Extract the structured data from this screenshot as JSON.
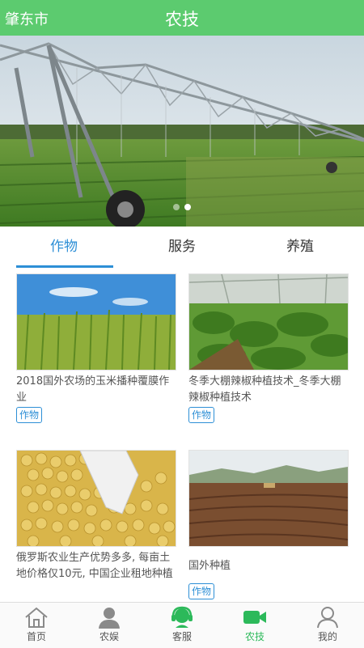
{
  "header": {
    "city": "肇东市",
    "title": "农技"
  },
  "banner": {
    "slide_count": 2,
    "active_slide": 2
  },
  "tabs": [
    {
      "label": "作物",
      "active": true
    },
    {
      "label": "服务",
      "active": false
    },
    {
      "label": "养殖",
      "active": false
    }
  ],
  "articles": [
    {
      "title": "2018国外农场的玉米播种覆膜作业",
      "tag": "作物"
    },
    {
      "title": "冬季大棚辣椒种植技术_冬季大棚辣椒种植技术",
      "tag": "作物"
    },
    {
      "title": "俄罗斯农业生产优势多多, 每亩土地价格仅10元, 中国企业租地种植",
      "tag": ""
    },
    {
      "title": "国外种植",
      "tag": "作物"
    }
  ],
  "nav": [
    {
      "label": "首页",
      "icon": "home-icon",
      "active": false
    },
    {
      "label": "农娱",
      "icon": "person-icon",
      "active": false
    },
    {
      "label": "客服",
      "icon": "headset-icon",
      "active": false
    },
    {
      "label": "农技",
      "icon": "video-camera-icon",
      "active": true
    },
    {
      "label": "我的",
      "icon": "user-icon",
      "active": false
    }
  ],
  "colors": {
    "header": "#5ccb6f",
    "accent": "#2d8fd6",
    "nav_active": "#2cb95a"
  }
}
